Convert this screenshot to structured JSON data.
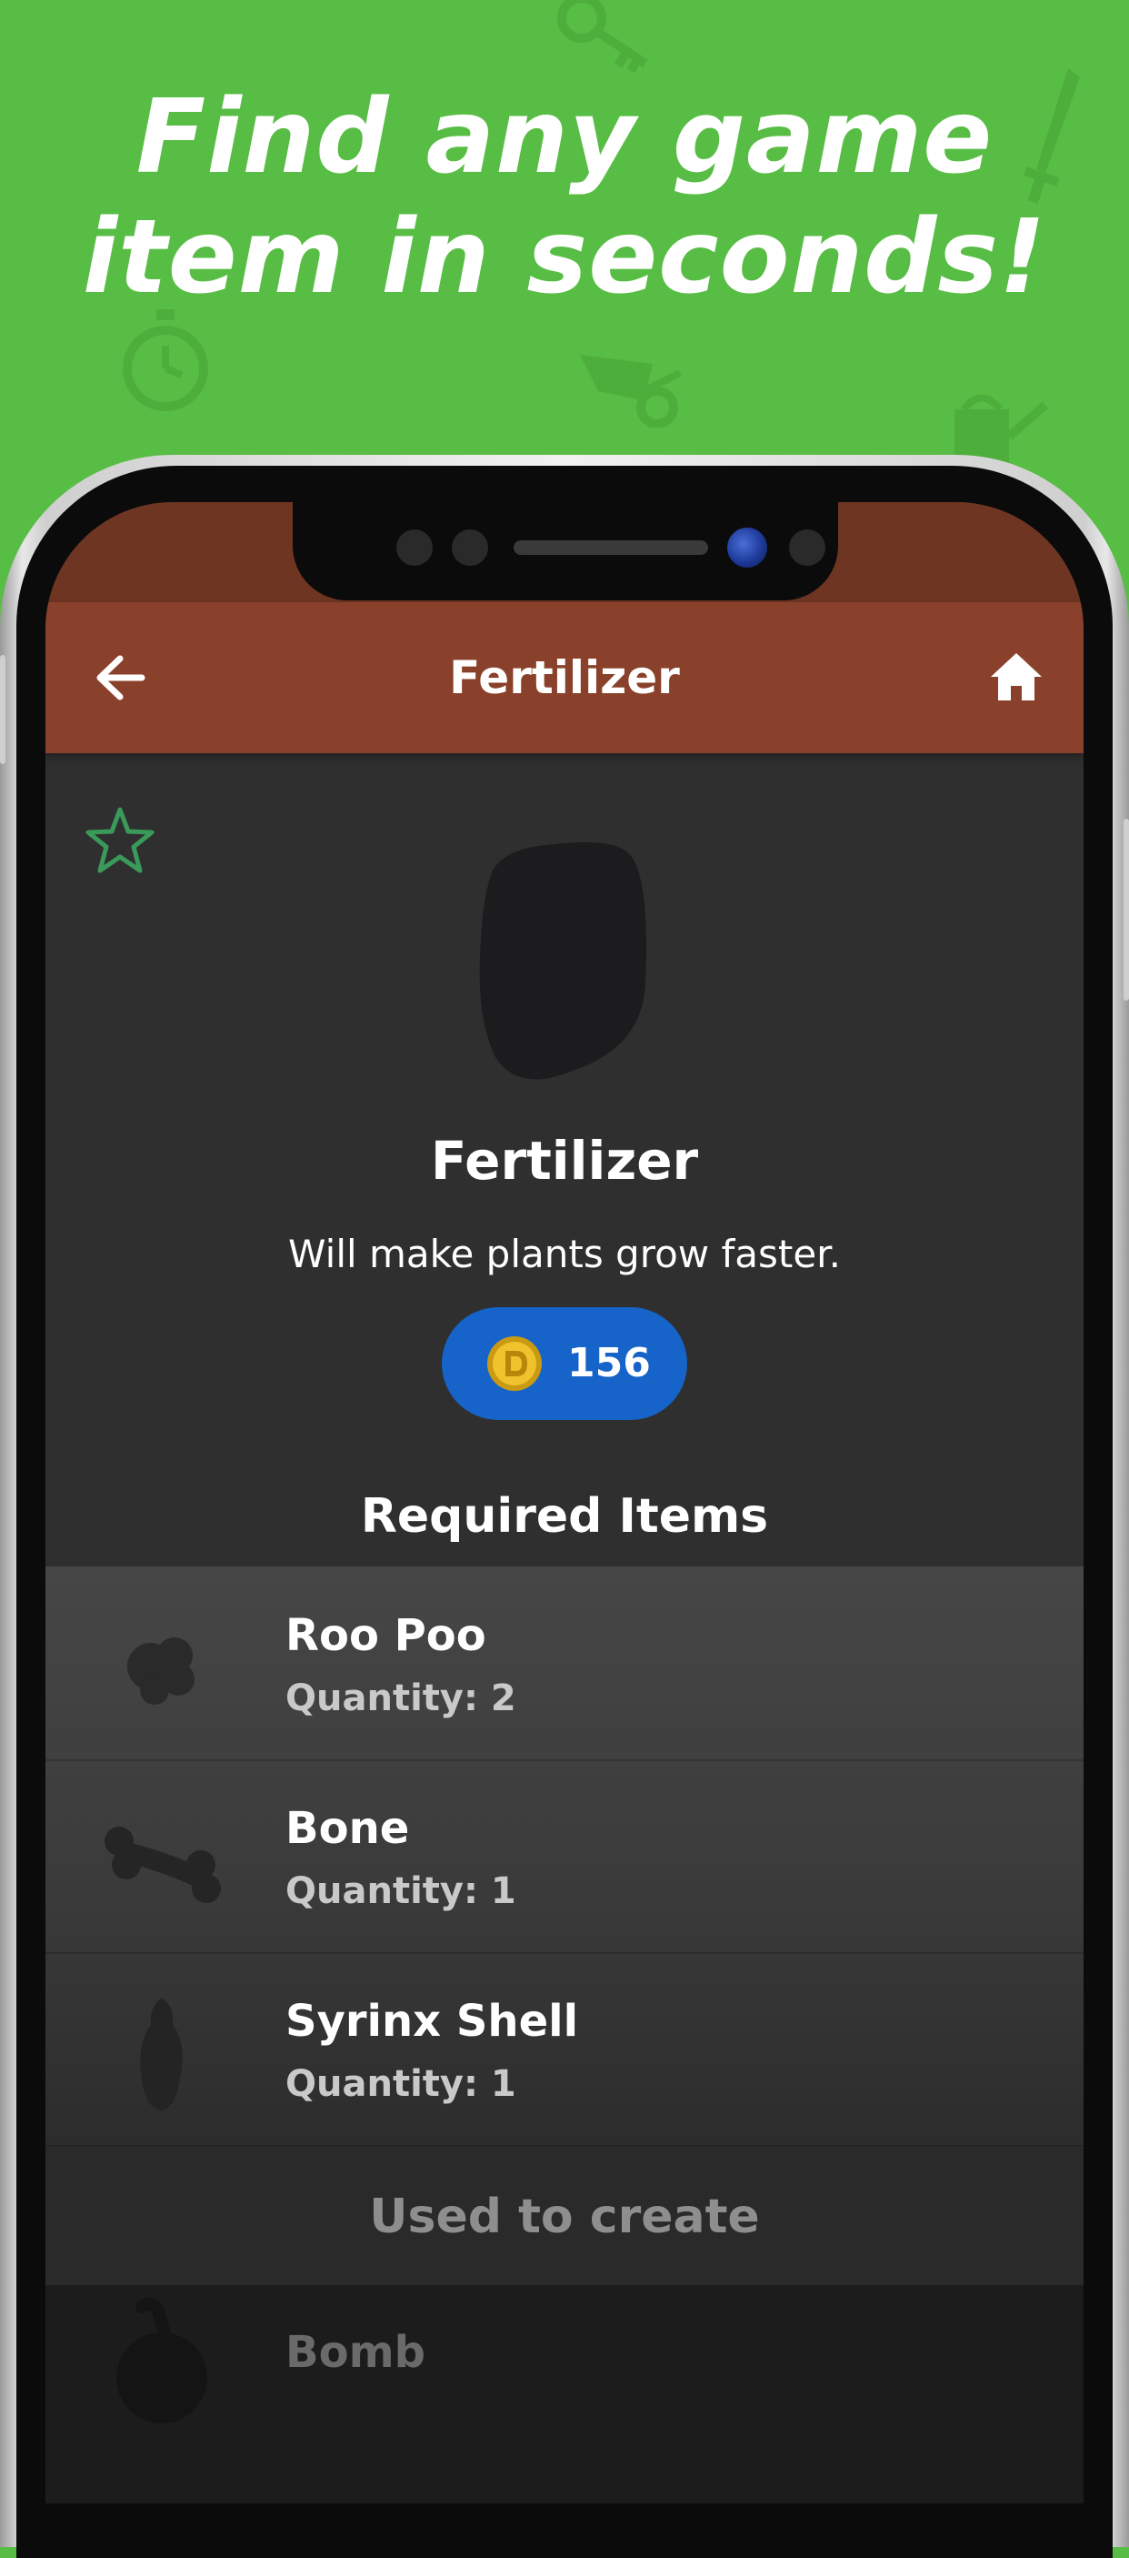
{
  "promo": {
    "headline_line1": "Find any game",
    "headline_line2": "item in seconds!"
  },
  "app_bar": {
    "title": "Fertilizer",
    "back_icon": "arrow-left-icon",
    "home_icon": "home-icon"
  },
  "item": {
    "name": "Fertilizer",
    "description": "Will make plants grow faster.",
    "price": "156",
    "currency_icon": "coin-icon",
    "favorite_icon": "star-outline-icon"
  },
  "required": {
    "title": "Required Items",
    "items": [
      {
        "name": "Roo Poo",
        "quantity": "Quantity: 2"
      },
      {
        "name": "Bone",
        "quantity": "Quantity: 1"
      },
      {
        "name": "Syrinx Shell",
        "quantity": "Quantity: 1"
      }
    ]
  },
  "used_to_create": {
    "title": "Used to create",
    "items": [
      {
        "name": "Bomb"
      }
    ]
  },
  "colors": {
    "background_green": "#58bd44",
    "app_bar_brown": "#8a412b",
    "price_blue": "#1663c9",
    "screen_dark": "#2f2f2f",
    "favorite_green": "#3a9a5a"
  }
}
